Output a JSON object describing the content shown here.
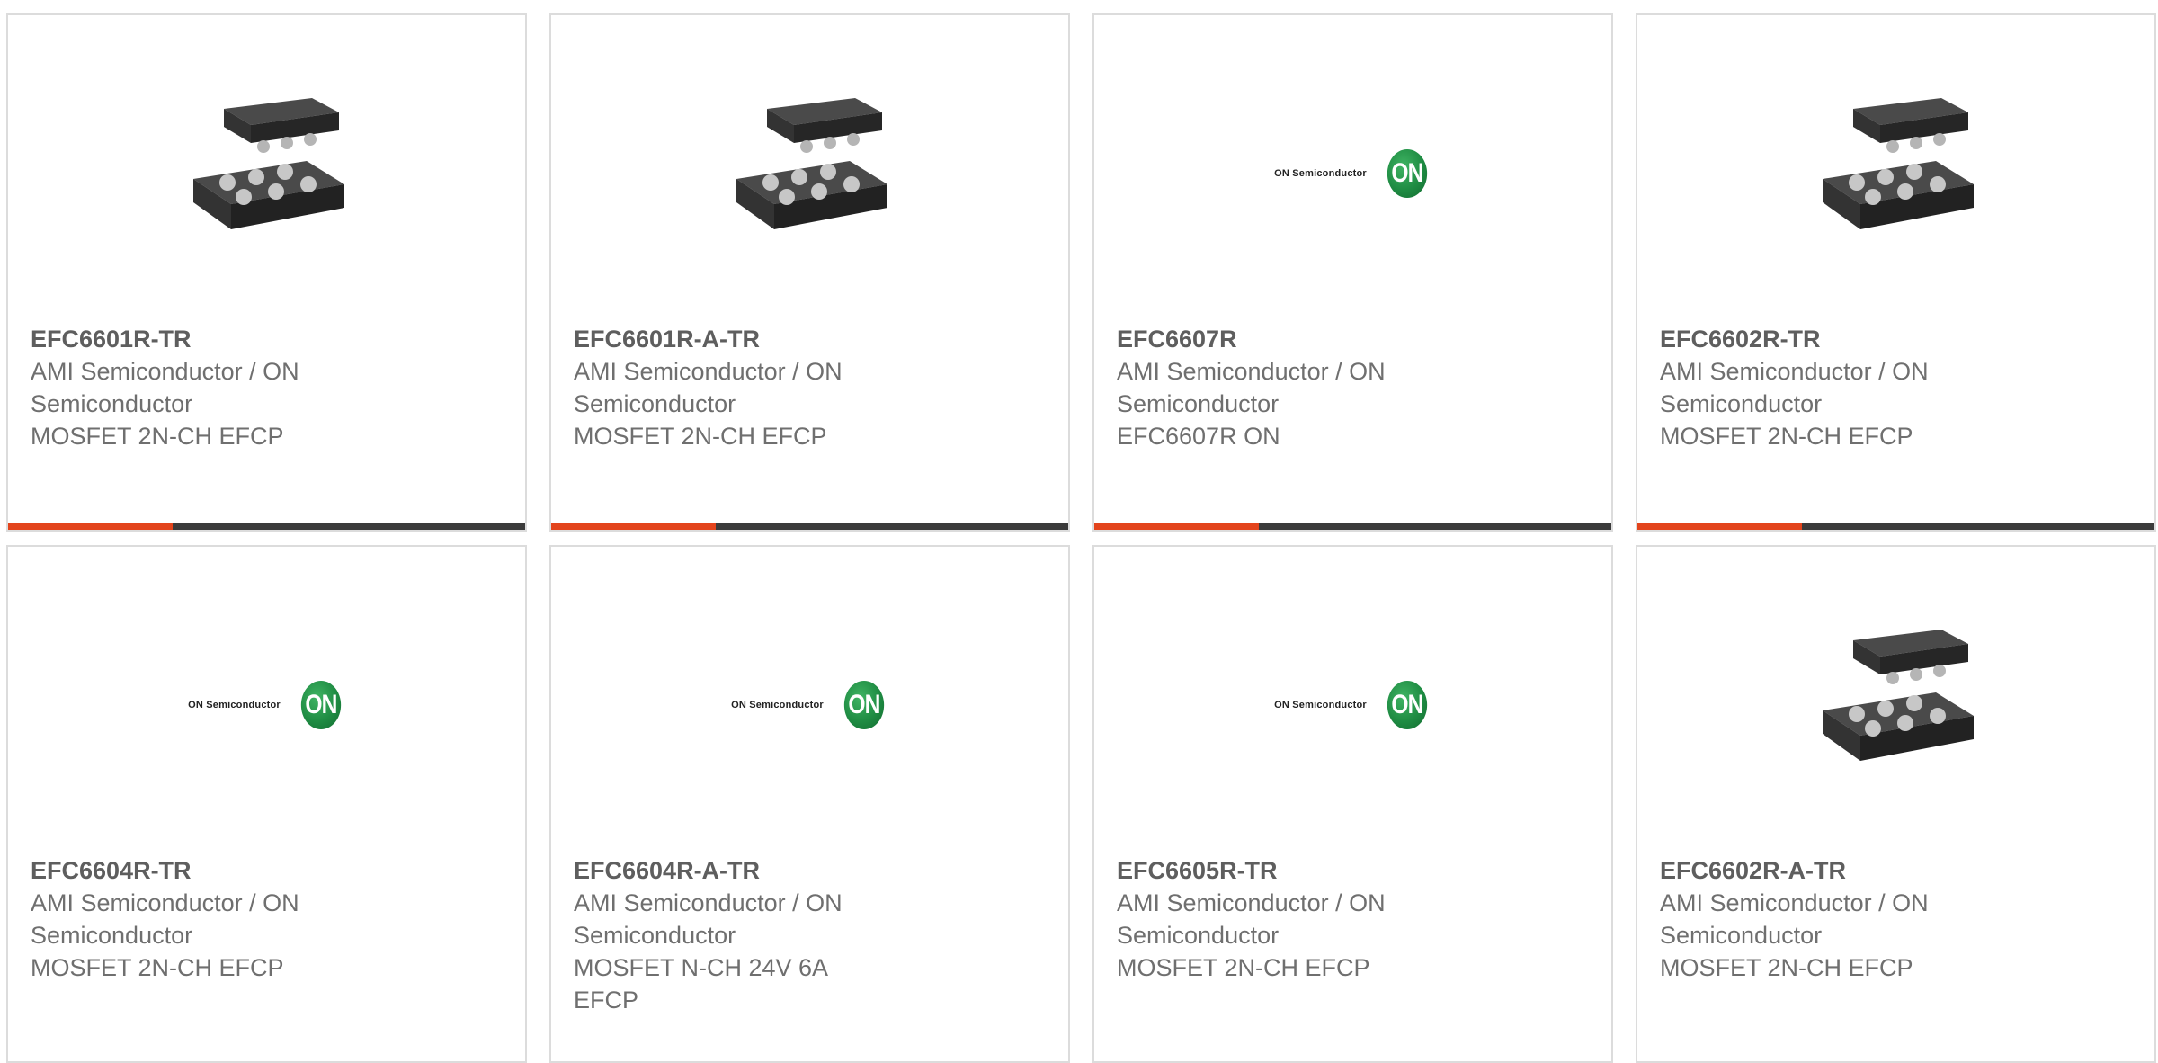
{
  "products": [
    {
      "part": "EFC6601R-TR",
      "manufacturer": "AMI Semiconductor / ON Semiconductor",
      "description": "MOSFET 2N-CH EFCP",
      "image": "chip-package-icon"
    },
    {
      "part": "EFC6601R-A-TR",
      "manufacturer": "AMI Semiconductor / ON Semiconductor",
      "description": "MOSFET 2N-CH EFCP",
      "image": "chip-package-icon"
    },
    {
      "part": "EFC6607R",
      "manufacturer": "AMI Semiconductor / ON Semiconductor",
      "description": "EFC6607R ON",
      "image": "on-semiconductor-logo",
      "logo_text": "ON Semiconductor",
      "logo_badge": "ON"
    },
    {
      "part": "EFC6602R-TR",
      "manufacturer": "AMI Semiconductor / ON Semiconductor",
      "description": "MOSFET 2N-CH EFCP",
      "image": "chip-package-icon"
    },
    {
      "part": "EFC6604R-TR",
      "manufacturer": "AMI Semiconductor / ON Semiconductor",
      "description": "MOSFET 2N-CH EFCP",
      "image": "on-semiconductor-logo",
      "logo_text": "ON Semiconductor",
      "logo_badge": "ON"
    },
    {
      "part": "EFC6604R-A-TR",
      "manufacturer": "AMI Semiconductor / ON Semiconductor",
      "description": "MOSFET N-CH 24V 6A EFCP",
      "image": "on-semiconductor-logo",
      "logo_text": "ON Semiconductor",
      "logo_badge": "ON"
    },
    {
      "part": "EFC6605R-TR",
      "manufacturer": "AMI Semiconductor / ON Semiconductor",
      "description": "MOSFET 2N-CH EFCP",
      "image": "on-semiconductor-logo",
      "logo_text": "ON Semiconductor",
      "logo_badge": "ON"
    },
    {
      "part": "EFC6602R-A-TR",
      "manufacturer": "AMI Semiconductor / ON Semiconductor",
      "description": "MOSFET 2N-CH EFCP",
      "image": "chip-package-icon"
    }
  ],
  "colors": {
    "accent": "#e3441c",
    "bar": "#3b3b3b",
    "text": "#6f6f6f",
    "border": "#dcdcdc",
    "logo_green": "#1f8c43"
  }
}
